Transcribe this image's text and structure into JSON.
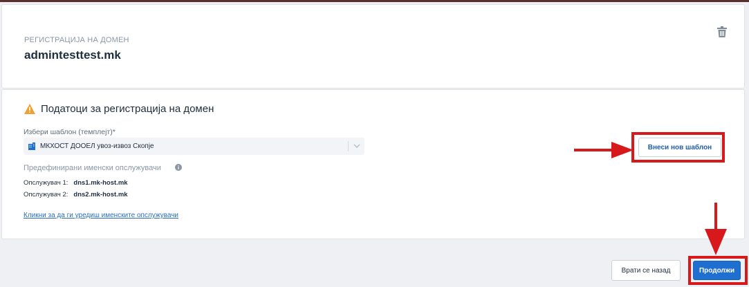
{
  "card_header": {
    "subtitle": "РЕГИСТРАЦИЈА НА ДОМЕН",
    "domain": "admintesttest.mk",
    "delete_icon": "trash-icon"
  },
  "registration": {
    "title": "Податоци за регистрација на домен",
    "warning_icon": "warning-icon",
    "template_label": "Избери шаблон (темплејт)*",
    "template_value": "МКХОСТ ДООЕЛ увоз-извоз Скопје",
    "template_icon": "building-icon",
    "new_template_button": "Внеси нов шаблон",
    "ns_title": "Предефинирани именски опслужувачи",
    "nameservers": [
      {
        "label": "Опслужувач 1:",
        "value": "dns1.mk-host.mk"
      },
      {
        "label": "Опслужувач 2:",
        "value": "dns2.mk-host.mk"
      }
    ],
    "edit_ns_link": "Кликни за да ги уредиш именските опслужувачи"
  },
  "footer": {
    "back_button": "Врати се назад",
    "continue_button": "Продолжи"
  },
  "colors": {
    "primary": "#1f6fd1",
    "highlight": "#d7191c",
    "warning": "#f0a030"
  }
}
